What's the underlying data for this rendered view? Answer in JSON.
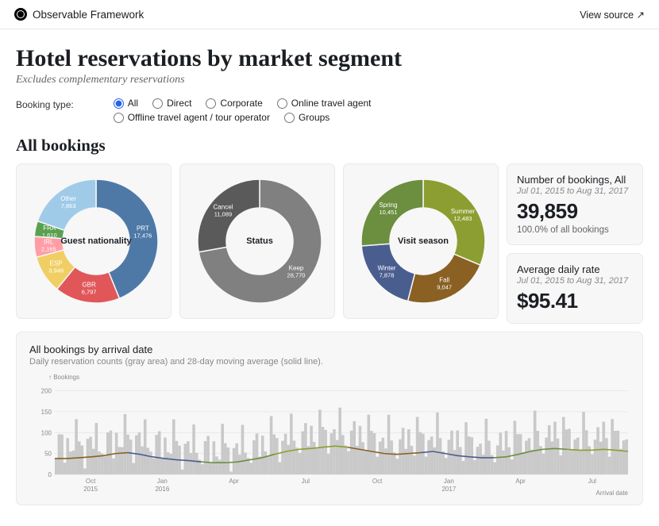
{
  "header": {
    "brand": "Observable Framework",
    "source": "View source"
  },
  "title": "Hotel reservations by market segment",
  "subtitle": "Excludes complementary reservations",
  "filter": {
    "label": "Booking type:",
    "options": [
      "All",
      "Direct",
      "Corporate",
      "Online travel agent",
      "Offline travel agent / tour operator",
      "Groups"
    ],
    "selected": "All"
  },
  "section_heading": "All bookings",
  "stats": {
    "bookings": {
      "label": "Number of bookings, All",
      "range": "Jul 01, 2015 to Aug 31, 2017",
      "value": "39,859",
      "sub": "100.0% of all bookings"
    },
    "rate": {
      "label": "Average daily rate",
      "range": "Jul 01, 2015 to Aug 31, 2017",
      "value": "$95.41"
    }
  },
  "timeseries": {
    "title": "All bookings by arrival date",
    "subtitle": "Daily reservation counts (gray area) and 28-day moving average (solid line).",
    "ylabel": "↑ Bookings",
    "xlabel": "Arrival date"
  },
  "chart_data": [
    {
      "type": "pie",
      "id": "guest_nationality",
      "title": "Guest nationality",
      "inner_radius": 0.5,
      "slices": [
        {
          "label": "PRT",
          "value": 17476,
          "color": "#4e79a7"
        },
        {
          "label": "GBR",
          "value": 6797,
          "color": "#e15759"
        },
        {
          "label": "ESP",
          "value": 3948,
          "color": "#f1ce63"
        },
        {
          "label": "IRL",
          "value": 2165,
          "color": "#ff9da7"
        },
        {
          "label": "FRA",
          "value": 1610,
          "color": "#59a14f"
        },
        {
          "label": "Other",
          "value": 7863,
          "color": "#a0cbe8"
        }
      ]
    },
    {
      "type": "pie",
      "id": "status",
      "title": "Status",
      "inner_radius": 0.5,
      "slices": [
        {
          "label": "Keep",
          "value": 28770,
          "color": "#808080"
        },
        {
          "label": "Cancel",
          "value": 11089,
          "color": "#5a5a5a"
        }
      ]
    },
    {
      "type": "pie",
      "id": "visit_season",
      "title": "Visit season",
      "inner_radius": 0.5,
      "slices": [
        {
          "label": "Summer",
          "value": 12483,
          "color": "#8c9e31"
        },
        {
          "label": "Fall",
          "value": 9047,
          "color": "#8a6023"
        },
        {
          "label": "Winter",
          "value": 7878,
          "color": "#4a5d8f"
        },
        {
          "label": "Spring",
          "value": 10451,
          "color": "#6b8e3f"
        }
      ]
    },
    {
      "type": "area+line",
      "id": "bookings_by_date",
      "title": "All bookings by arrival date",
      "ylabel": "Bookings",
      "xlabel": "Arrival date",
      "ylim": [
        0,
        220
      ],
      "x_ticks": [
        "Oct 2015",
        "Jan 2016",
        "Apr",
        "Jul",
        "Oct",
        "Jan 2017",
        "Apr",
        "Jul"
      ],
      "note": "gray area = daily counts; colored line = 28-day moving average tinted by season",
      "moving_avg_approx": [
        38,
        38,
        40,
        42,
        45,
        50,
        52,
        48,
        42,
        38,
        35,
        33,
        30,
        28,
        28,
        30,
        35,
        40,
        48,
        55,
        60,
        62,
        65,
        68,
        65,
        60,
        55,
        50,
        48,
        50,
        52,
        55,
        50,
        45,
        42,
        40,
        40,
        42,
        48,
        55,
        60,
        62,
        60,
        58,
        58,
        60,
        58,
        55
      ],
      "season_colors": {
        "Summer": "#8c9e31",
        "Fall": "#8a6023",
        "Winter": "#4a5d8f",
        "Spring": "#6b8e3f"
      }
    }
  ]
}
